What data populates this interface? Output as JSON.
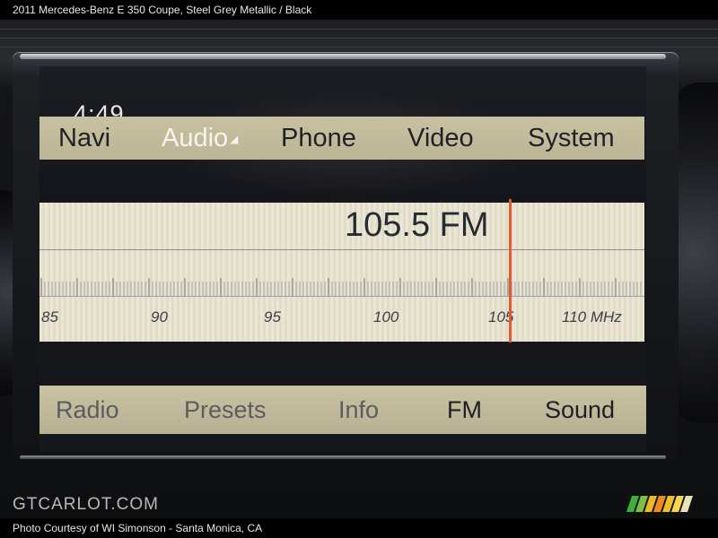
{
  "caption": {
    "text": "2011 Mercedes-Benz E 350 Coupe,  Steel Grey Metallic / Black"
  },
  "screen": {
    "clock": "4:49",
    "main_menu": [
      {
        "label": "Navi",
        "active": false
      },
      {
        "label": "Audio",
        "active": true
      },
      {
        "label": "Phone",
        "active": false
      },
      {
        "label": "Video",
        "active": false
      },
      {
        "label": "System",
        "active": false
      }
    ],
    "tuner": {
      "frequency": "105.5 FM",
      "scale_labels": [
        "85",
        "90",
        "95",
        "100",
        "105",
        "110 MHz"
      ],
      "scale_min_mhz": 84.5,
      "scale_max_mhz": 111.5,
      "needle_mhz": 105.5,
      "needle_color": "#e05a36"
    },
    "sub_menu": [
      {
        "label": "Radio",
        "emphasis": false
      },
      {
        "label": "Presets",
        "emphasis": false
      },
      {
        "label": "Info",
        "emphasis": false
      },
      {
        "label": "FM",
        "emphasis": true
      },
      {
        "label": "Sound",
        "emphasis": true
      }
    ],
    "menu_bar_color": "#c8c1a1"
  },
  "watermark": {
    "text": "GTCARLOT.COM"
  },
  "credit": {
    "text": "Photo Courtesy of WI Simonson - Santa Monica, CA"
  }
}
